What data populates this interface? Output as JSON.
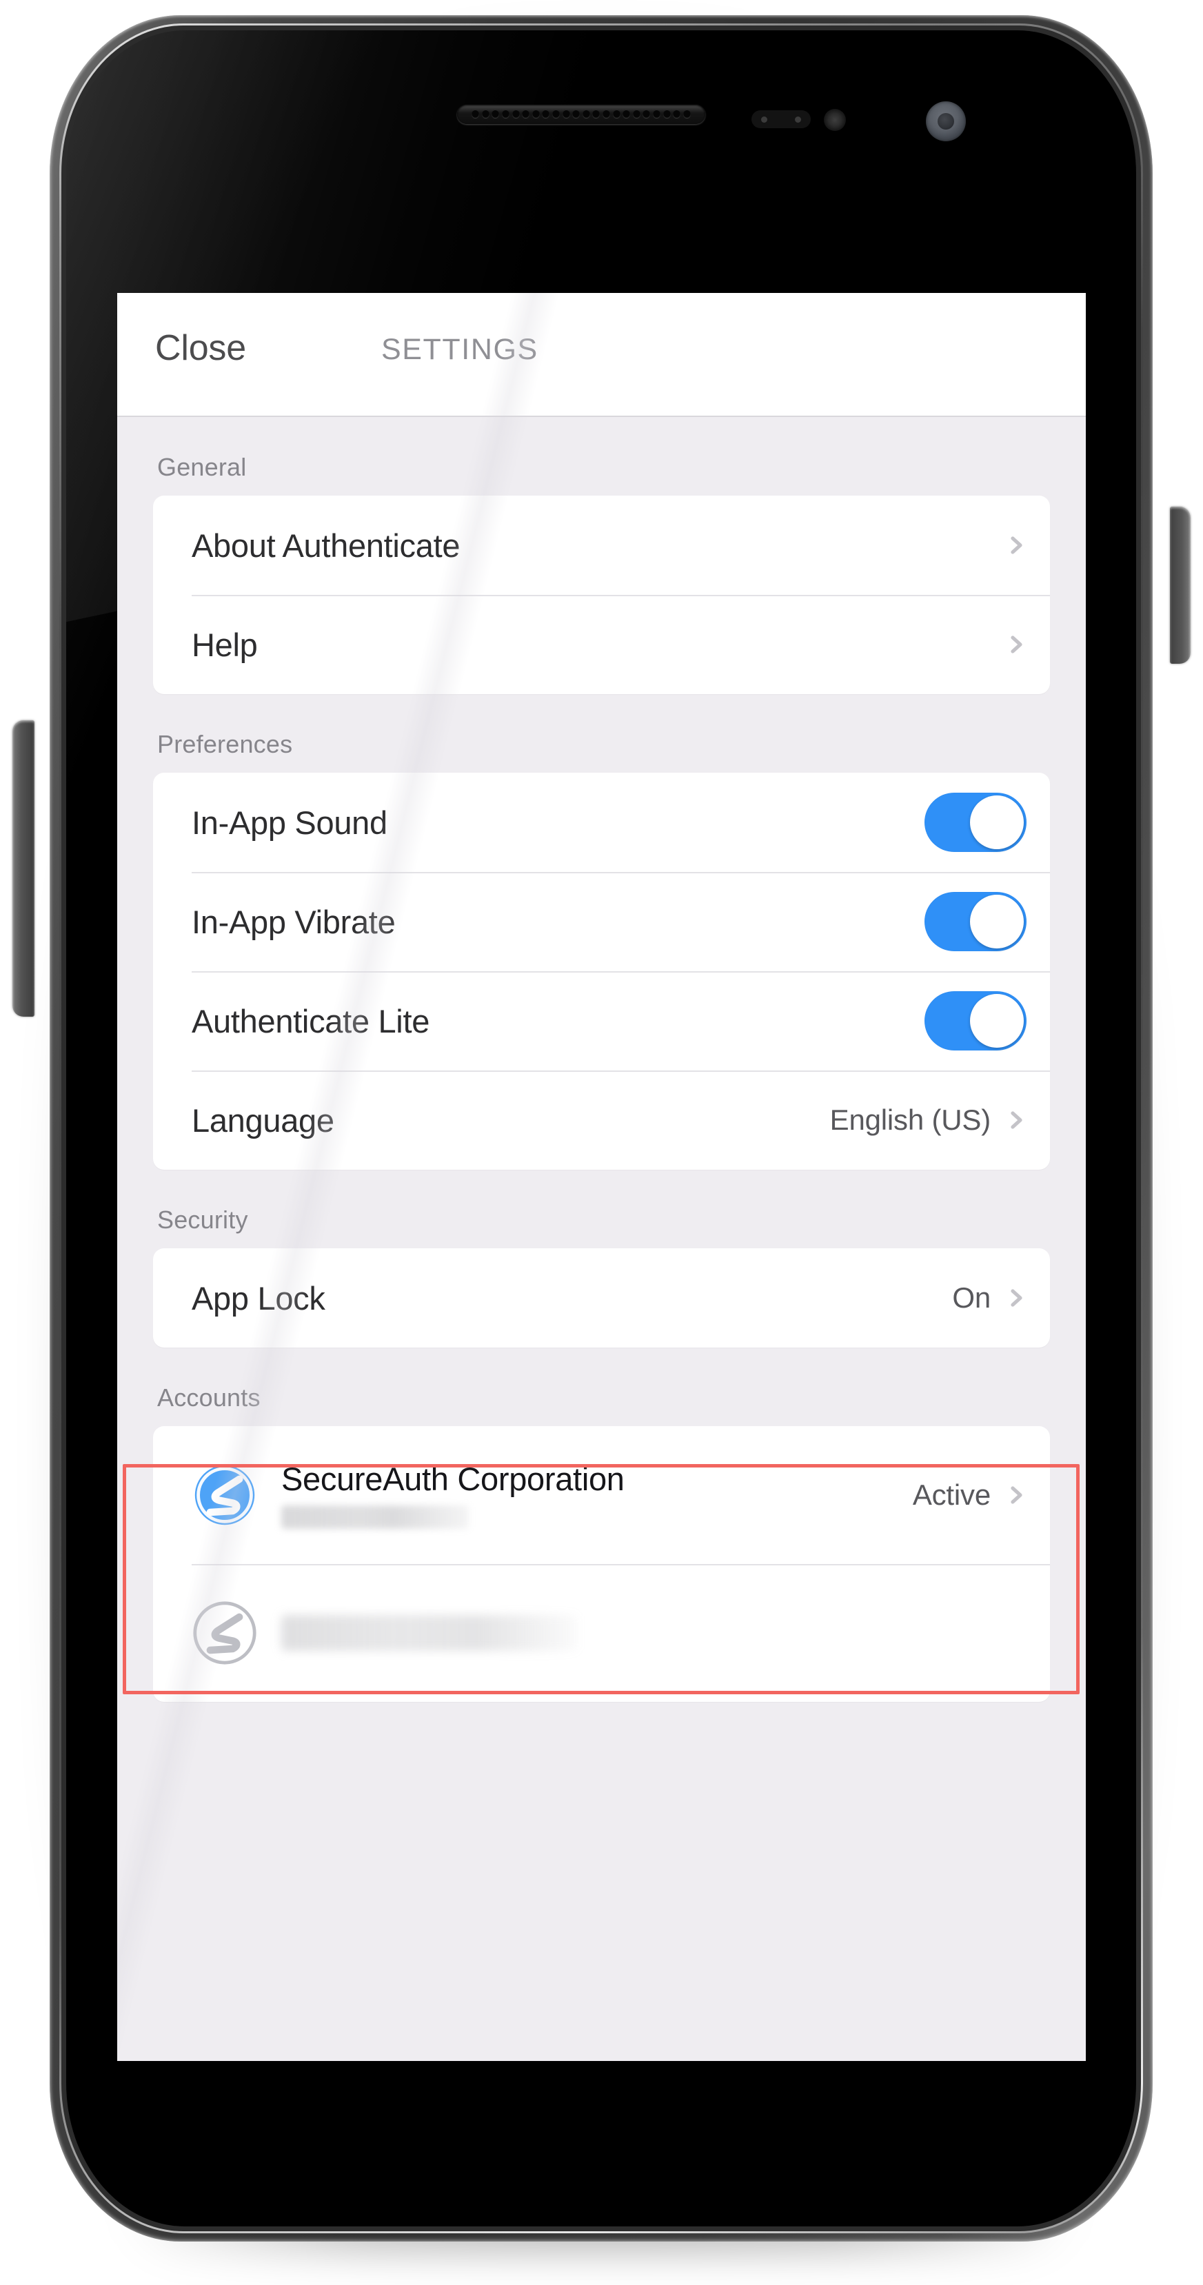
{
  "device": {
    "earpiece_hole_count": 22,
    "icons": {
      "earpiece": "speaker-grille-icon",
      "proximity": "proximity-sensor-icon",
      "camera": "front-camera-icon",
      "volume": "volume-rocker-button",
      "power": "power-button"
    }
  },
  "screen": {
    "navbar": {
      "close_label": "Close",
      "title": "SETTINGS"
    },
    "sections": [
      {
        "header": "General",
        "rows": [
          {
            "label": "About Authenticate",
            "type": "link",
            "value": ""
          },
          {
            "label": "Help",
            "type": "link",
            "value": ""
          }
        ]
      },
      {
        "header": "Preferences",
        "rows": [
          {
            "label": "In-App Sound",
            "type": "toggle",
            "value": "On"
          },
          {
            "label": "In-App Vibrate",
            "type": "toggle",
            "value": "On"
          },
          {
            "label": "Authenticate Lite",
            "type": "toggle",
            "value": "On"
          },
          {
            "label": "Language",
            "type": "link",
            "value": "English (US)"
          }
        ]
      },
      {
        "header": "Security",
        "highlighted": true,
        "rows": [
          {
            "label": "App Lock",
            "type": "link",
            "value": "On"
          }
        ]
      },
      {
        "header": "Accounts",
        "rows": [
          {
            "label": "SecureAuth Corporation",
            "type": "account",
            "value": "Active",
            "subtitle_redacted": true
          },
          {
            "label": "",
            "type": "account-partial",
            "value": "",
            "subtitle_redacted": true
          }
        ]
      }
    ]
  },
  "colors": {
    "toggle_on": "#2F90F7",
    "screen_background": "#EFEDF1",
    "card_background": "#FFFFFF",
    "row_label": "#2D2D2F",
    "section_header": "#86858B",
    "navbar_title": "#8F8F94",
    "chevron": "#C4C3C8",
    "highlight_border": "#F2655F",
    "account_logo_blue": "#4EA3F7"
  }
}
